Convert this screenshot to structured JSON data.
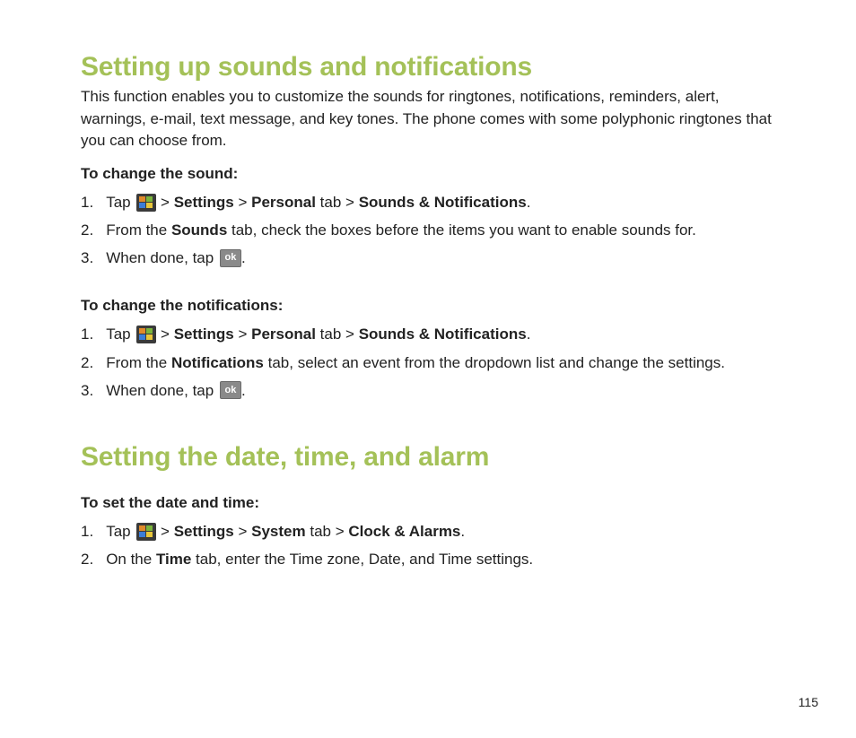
{
  "page_number": "115",
  "sections": {
    "sounds": {
      "heading": "Setting up sounds and notifications",
      "intro": "This function enables you to customize the sounds for ringtones, notifications, reminders, alert, warnings, e-mail, text message, and key tones. The phone comes with some polyphonic ringtones that you can choose from.",
      "change_sound": {
        "title": "To change the sound:",
        "steps": {
          "s1": {
            "num": "1.",
            "tap": "Tap ",
            "gt1": " > ",
            "settings": "Settings",
            "gt2": " > ",
            "personal": "Personal",
            "tab": " tab > ",
            "sn": "Sounds & Notifications",
            "dot": "."
          },
          "s2": {
            "num": "2.",
            "a": "From the ",
            "b": "Sounds",
            "c": " tab, check the boxes before the items you want to enable sounds for."
          },
          "s3": {
            "num": "3.",
            "a": "When done, tap ",
            "ok": "ok",
            "dot": "."
          }
        }
      },
      "change_notif": {
        "title": "To change the notifications:",
        "steps": {
          "s1": {
            "num": "1.",
            "tap": "Tap ",
            "gt1": " > ",
            "settings": "Settings",
            "gt2": " > ",
            "personal": "Personal",
            "tab": " tab > ",
            "sn": "Sounds & Notifications",
            "dot": "."
          },
          "s2": {
            "num": "2.",
            "a": "From the ",
            "b": "Notifications",
            "c": " tab, select an event from the dropdown list and change the settings."
          },
          "s3": {
            "num": "3.",
            "a": "When done, tap ",
            "ok": "ok",
            "dot": "."
          }
        }
      }
    },
    "datetime": {
      "heading": "Setting the date, time, and alarm",
      "set_dt": {
        "title": "To set the date and time:",
        "steps": {
          "s1": {
            "num": "1.",
            "tap": "Tap ",
            "gt1": " > ",
            "settings": "Settings",
            "gt2": " > ",
            "system": "System",
            "tab": " tab > ",
            "ca": "Clock & Alarms",
            "dot": "."
          },
          "s2": {
            "num": "2.",
            "a": "On the ",
            "b": "Time",
            "c": " tab, enter the Time zone, Date, and Time settings."
          }
        }
      }
    }
  },
  "icons": {
    "start": "windows-start-icon",
    "ok": "ok-icon"
  }
}
